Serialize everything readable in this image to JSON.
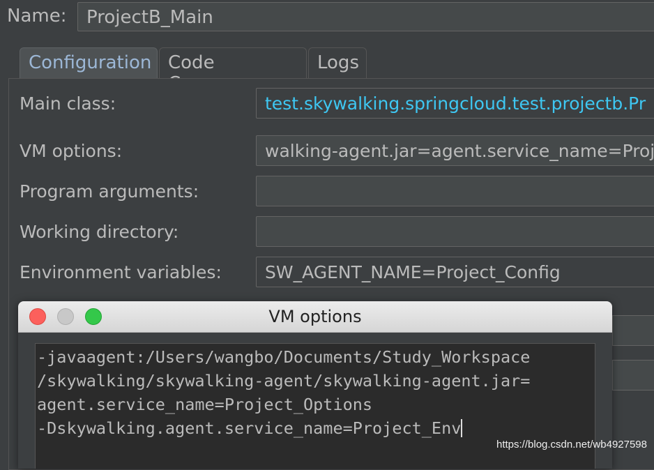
{
  "name_label": "Name:",
  "name_value": "ProjectB_Main",
  "tabs": [
    {
      "label": "Configuration"
    },
    {
      "label": "Code Coverage"
    },
    {
      "label": "Logs"
    }
  ],
  "form": {
    "main_class_label": "Main class:",
    "main_class_value": "test.skywalking.springcloud.test.projectb.Pr",
    "vm_options_label": "VM options:",
    "vm_options_value": "walking-agent.jar=agent.service_name=Proj",
    "program_args_label": "Program arguments:",
    "program_args_value": "",
    "working_dir_label": "Working directory:",
    "working_dir_value": "",
    "env_vars_label": "Environment variables:",
    "env_vars_value": "SW_AGENT_NAME=Project_Config"
  },
  "dialog": {
    "title": "VM options",
    "lines": [
      "-javaagent:/Users/wangbo/Documents/Study_Workspace",
      "/skywalking/skywalking-agent/skywalking-agent.jar=",
      "agent.service_name=Project_Options",
      "-Dskywalking.agent.service_name=Project_Env"
    ]
  },
  "watermark": "https://blog.csdn.net/wb4927598"
}
